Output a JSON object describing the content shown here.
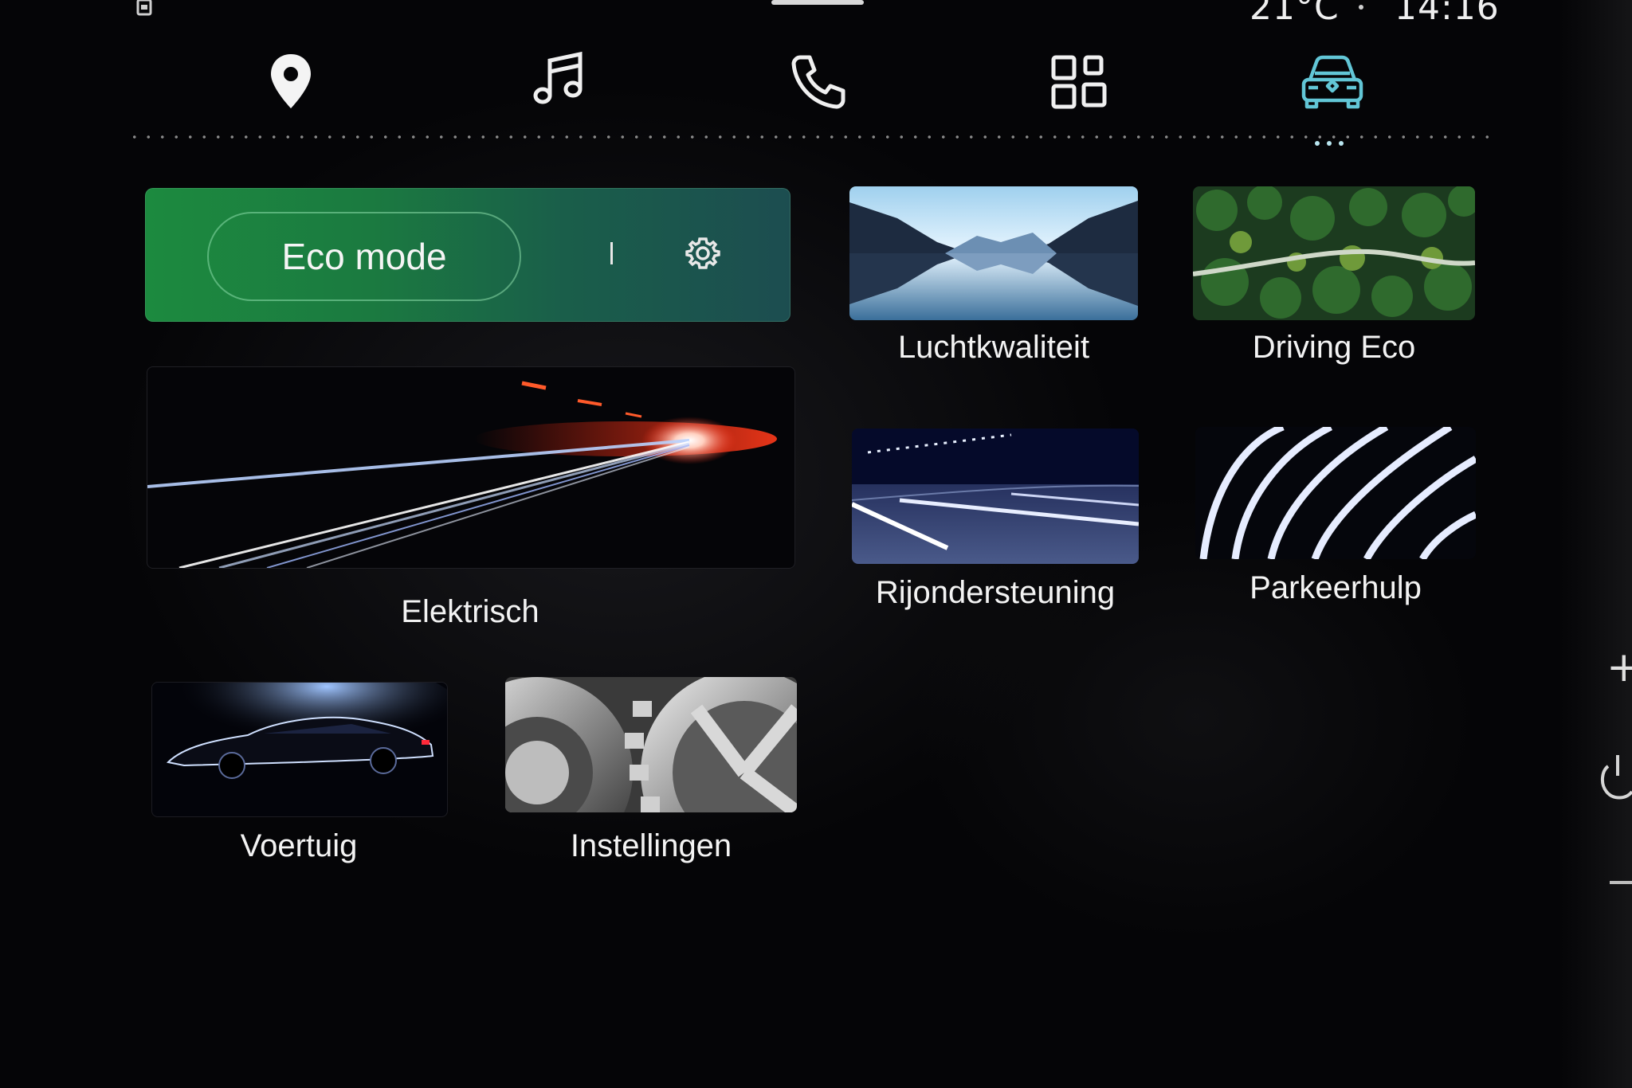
{
  "status_bar": {
    "temperature": "21°C",
    "time": "14:16"
  },
  "nav": {
    "items": [
      {
        "name": "navigation",
        "icon": "map-pin-icon",
        "active": false
      },
      {
        "name": "music",
        "icon": "music-note-icon",
        "active": false
      },
      {
        "name": "phone",
        "icon": "phone-icon",
        "active": false
      },
      {
        "name": "apps",
        "icon": "apps-grid-icon",
        "active": false
      },
      {
        "name": "vehicle",
        "icon": "car-icon",
        "active": true
      }
    ],
    "active_color": "#62c6d6"
  },
  "eco": {
    "label": "Eco mode",
    "color": "#1c8a3f"
  },
  "tiles": {
    "luchtkwaliteit": "Luchtkwaliteit",
    "driving_eco": "Driving Eco",
    "elektrisch": "Elektrisch",
    "rijondersteuning": "Rijondersteuning",
    "parkeerhulp": "Parkeerhulp",
    "voertuig": "Voertuig",
    "instellingen": "Instellingen"
  },
  "side_controls": {
    "plus": "+"
  }
}
